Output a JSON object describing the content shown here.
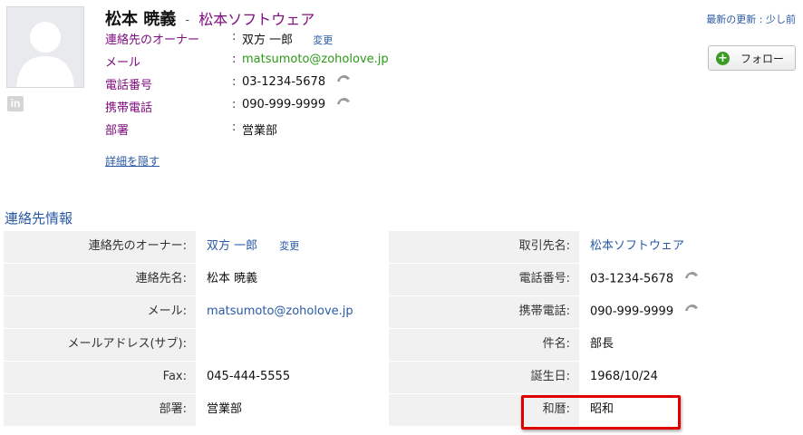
{
  "header": {
    "contact_name": "松本 暁義",
    "separator": "-",
    "account_name": "松本ソフトウェア",
    "last_update": "最新の更新 : 少し前",
    "follow_label": "フォロー",
    "hide_details": "詳細を隠す",
    "linkedin_label": "in"
  },
  "summary": {
    "colon": ":",
    "owner_label": "連絡先のオーナー",
    "owner_value": "双方 一郎",
    "change_label": "変更",
    "email_label": "メール",
    "email_value": "matsumoto@zoholove.jp",
    "phone_label": "電話番号",
    "phone_value": "03-1234-5678",
    "mobile_label": "携帯電話",
    "mobile_value": "090-999-9999",
    "dept_label": "部署",
    "dept_value": "営業部"
  },
  "section": {
    "title": "連絡先情報",
    "rows": [
      {
        "l1": "連絡先のオーナー:",
        "v1": "双方 一郎",
        "v1_extra": "変更",
        "l2": "取引先名:",
        "v2": "松本ソフトウェア"
      },
      {
        "l1": "連絡先名:",
        "v1": "松本 暁義",
        "l2": "電話番号:",
        "v2": "03-1234-5678"
      },
      {
        "l1": "メール:",
        "v1": "matsumoto@zoholove.jp",
        "l2": "携帯電話:",
        "v2": "090-999-9999"
      },
      {
        "l1": "メールアドレス(サブ):",
        "v1": "",
        "l2": "件名:",
        "v2": "部長"
      },
      {
        "l1": "Fax:",
        "v1": "045-444-5555",
        "l2": "誕生日:",
        "v2": "1968/10/24"
      },
      {
        "l1": "部署:",
        "v1": "営業部",
        "l2": "和暦:",
        "v2": "昭和"
      }
    ]
  },
  "colors": {
    "link": "#2a5aa5",
    "label_purple": "#800e80",
    "email_green": "#2a9a17",
    "highlight_red": "#e00000"
  }
}
